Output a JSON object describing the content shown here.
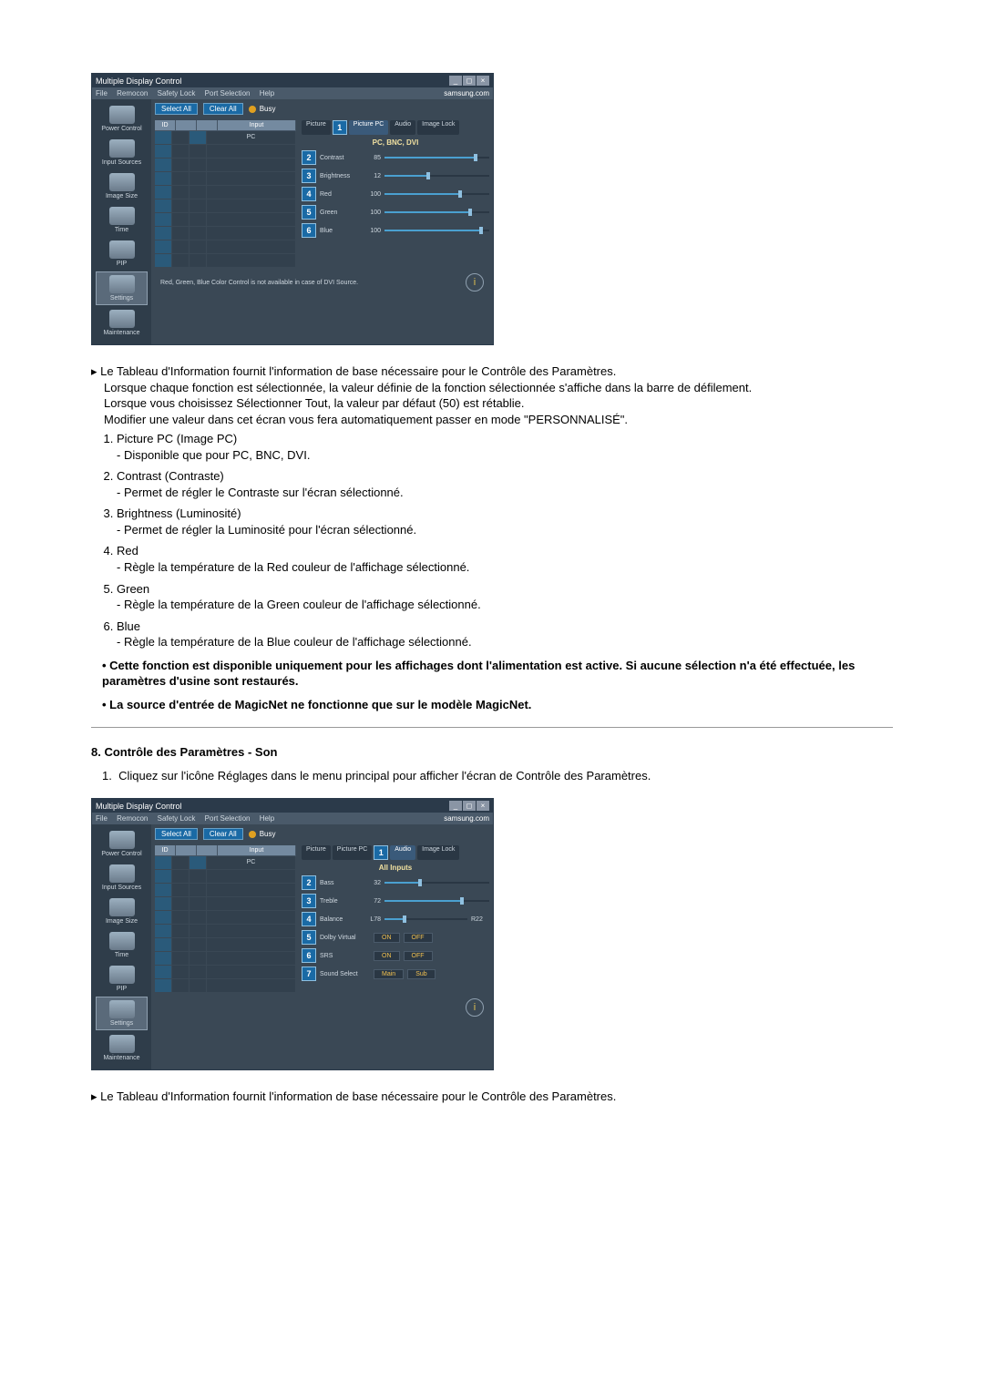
{
  "app": {
    "title": "Multiple Display Control",
    "menu": [
      "File",
      "Remocon",
      "Safety Lock",
      "Port Selection",
      "Help"
    ],
    "version_hint": "samsung.com",
    "sidebar": [
      {
        "label": "Power Control"
      },
      {
        "label": "Input Sources"
      },
      {
        "label": "Image Size"
      },
      {
        "label": "Time"
      },
      {
        "label": "PIP"
      },
      {
        "label": "Settings",
        "active": true
      },
      {
        "label": "Maintenance"
      }
    ],
    "buttons": {
      "select_all": "Select All",
      "clear_all": "Clear All"
    },
    "busy": "Busy",
    "grid": {
      "headers": [
        "ID",
        "",
        "",
        "Input"
      ],
      "row1": {
        "input": "PC"
      },
      "blank_rows": 9
    }
  },
  "picture_panel": {
    "tabs": [
      "Picture",
      "Picture PC",
      "Audio",
      "Image Lock"
    ],
    "active_tab_index": 1,
    "badge1": "1",
    "subtitle": "PC, BNC, DVI",
    "sliders": [
      {
        "badge": "2",
        "label": "Contrast",
        "value": "85",
        "pct": 85
      },
      {
        "badge": "3",
        "label": "Brightness",
        "value": "12",
        "pct": 40
      },
      {
        "badge": "4",
        "label": "Red",
        "value": "100",
        "pct": 70
      },
      {
        "badge": "5",
        "label": "Green",
        "value": "100",
        "pct": 80
      },
      {
        "badge": "6",
        "label": "Blue",
        "value": "100",
        "pct": 90
      }
    ],
    "footer": "Red, Green, Blue Color Control is not available in case of DVI Source."
  },
  "audio_panel": {
    "tabs": [
      "Picture",
      "Picture PC",
      "Audio",
      "Image Lock"
    ],
    "active_tab_index": 2,
    "badge1": "1",
    "subtitle": "All Inputs",
    "sliders": [
      {
        "badge": "2",
        "label": "Bass",
        "value": "32",
        "pct": 32
      },
      {
        "badge": "3",
        "label": "Treble",
        "value": "72",
        "pct": 72
      },
      {
        "badge": "4",
        "label": "Balance",
        "left": "L78",
        "right": "R22",
        "pct": 22
      }
    ],
    "toggles": [
      {
        "badge": "5",
        "label": "Dolby Virtual",
        "on": "ON",
        "off": "OFF"
      },
      {
        "badge": "6",
        "label": "SRS",
        "on": "ON",
        "off": "OFF"
      },
      {
        "badge": "7",
        "label": "Sound Select",
        "on": "Main",
        "off": "Sub"
      }
    ]
  },
  "doc1": {
    "intro_arrow": "Le Tableau d'Information fournit l'information de base nécessaire pour le Contrôle des Paramètres.",
    "intro2": "Lorsque chaque fonction est sélectionnée, la valeur définie de la fonction sélectionnée s'affiche dans la barre de défilement.",
    "intro3": "Lorsque vous choisissez Sélectionner Tout, la valeur par défaut (50) est rétablie.",
    "intro4": "Modifier une valeur dans cet écran vous fera automatiquement passer en mode \"PERSONNALISÉ\".",
    "items": [
      {
        "t": "Picture PC (Image PC)",
        "d": "- Disponible que pour PC, BNC, DVI."
      },
      {
        "t": "Contrast (Contraste)",
        "d": "- Permet de régler le Contraste sur l'écran sélectionné."
      },
      {
        "t": "Brightness (Luminosité)",
        "d": "- Permet de régler la Luminosité pour l'écran sélectionné."
      },
      {
        "t": "Red",
        "d": "- Règle la température de la Red couleur de l'affichage sélectionné."
      },
      {
        "t": "Green",
        "d": "- Règle la température de la Green couleur de l'affichage sélectionné."
      },
      {
        "t": "Blue",
        "d": "- Règle la température de la Blue couleur de l'affichage sélectionné."
      }
    ],
    "bold1": "Cette fonction est disponible uniquement pour les affichages dont l'alimentation est active. Si aucune sélection n'a été effectuée, les paramètres d'usine sont restaurés.",
    "bold2": "La source d'entrée de MagicNet ne fonctionne que sur le modèle MagicNet."
  },
  "section8": {
    "title": "8. Contrôle des Paramètres - Son",
    "step1": "Cliquez sur l'icône Réglages dans le menu principal pour afficher l'écran de Contrôle des Paramètres."
  },
  "doc2": {
    "footer_arrow": "Le Tableau d'Information fournit l'information de base nécessaire pour le Contrôle des Paramètres."
  }
}
